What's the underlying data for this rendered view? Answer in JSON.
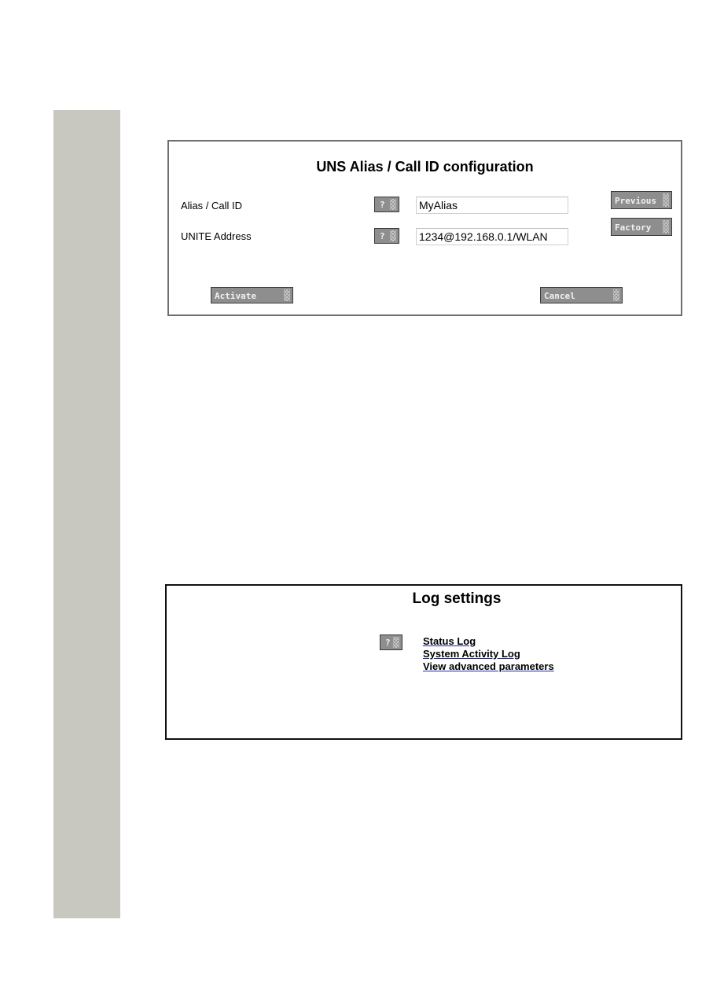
{
  "uns_panel": {
    "title": "UNS Alias / Call ID configuration",
    "fields": [
      {
        "label": "Alias / Call ID",
        "value": "MyAlias",
        "help": "?"
      },
      {
        "label": "UNITE Address",
        "value": "1234@192.168.0.1/WLAN",
        "help": "?"
      }
    ],
    "buttons": {
      "previous": "Previous",
      "factory": "Factory",
      "activate": "Activate",
      "cancel": "Cancel"
    }
  },
  "log_panel": {
    "title": "Log settings",
    "help": "?",
    "links": [
      "Status Log",
      "System Activity Log",
      "View advanced parameters"
    ]
  }
}
